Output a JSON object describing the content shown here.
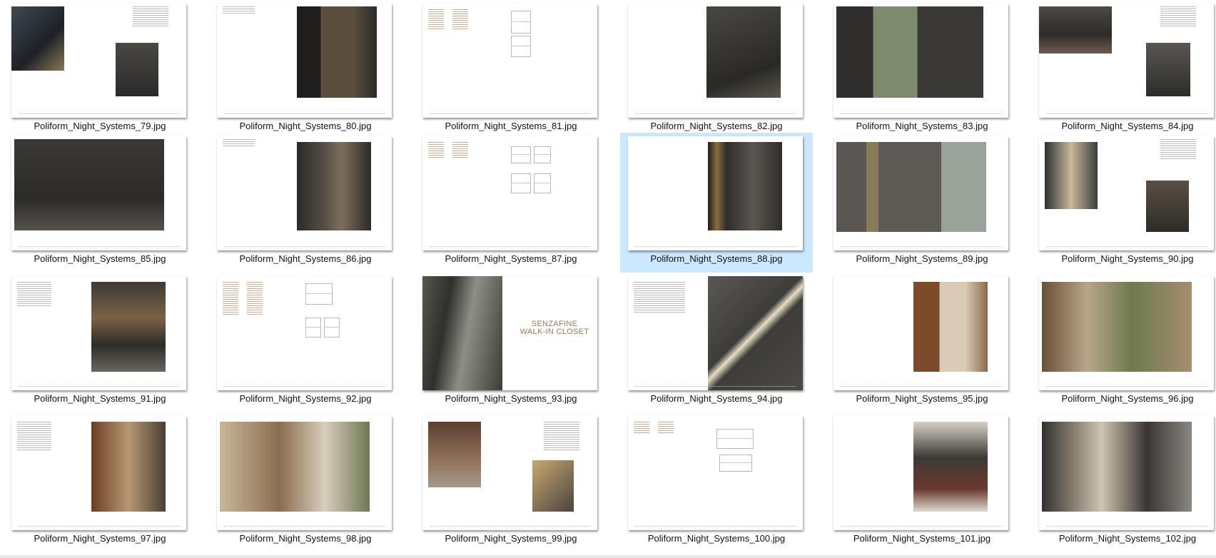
{
  "files": [
    {
      "name": "Poliform_Night_Systems_79.jpg"
    },
    {
      "name": "Poliform_Night_Systems_80.jpg"
    },
    {
      "name": "Poliform_Night_Systems_81.jpg"
    },
    {
      "name": "Poliform_Night_Systems_82.jpg"
    },
    {
      "name": "Poliform_Night_Systems_83.jpg"
    },
    {
      "name": "Poliform_Night_Systems_84.jpg"
    },
    {
      "name": "Poliform_Night_Systems_85.jpg"
    },
    {
      "name": "Poliform_Night_Systems_86.jpg"
    },
    {
      "name": "Poliform_Night_Systems_87.jpg"
    },
    {
      "name": "Poliform_Night_Systems_88.jpg",
      "selected": true
    },
    {
      "name": "Poliform_Night_Systems_89.jpg"
    },
    {
      "name": "Poliform_Night_Systems_90.jpg"
    },
    {
      "name": "Poliform_Night_Systems_91.jpg"
    },
    {
      "name": "Poliform_Night_Systems_92.jpg"
    },
    {
      "name": "Poliform_Night_Systems_93.jpg",
      "page_title": [
        "SENZAFINE",
        "WALK-IN CLOSET"
      ]
    },
    {
      "name": "Poliform_Night_Systems_94.jpg"
    },
    {
      "name": "Poliform_Night_Systems_95.jpg"
    },
    {
      "name": "Poliform_Night_Systems_96.jpg"
    },
    {
      "name": "Poliform_Night_Systems_97.jpg"
    },
    {
      "name": "Poliform_Night_Systems_98.jpg"
    },
    {
      "name": "Poliform_Night_Systems_99.jpg"
    },
    {
      "name": "Poliform_Night_Systems_100.jpg"
    },
    {
      "name": "Poliform_Night_Systems_101.jpg"
    },
    {
      "name": "Poliform_Night_Systems_102.jpg"
    }
  ],
  "colors": {
    "selection": "#cce8ff",
    "accent_text": "#9b7b5e"
  }
}
